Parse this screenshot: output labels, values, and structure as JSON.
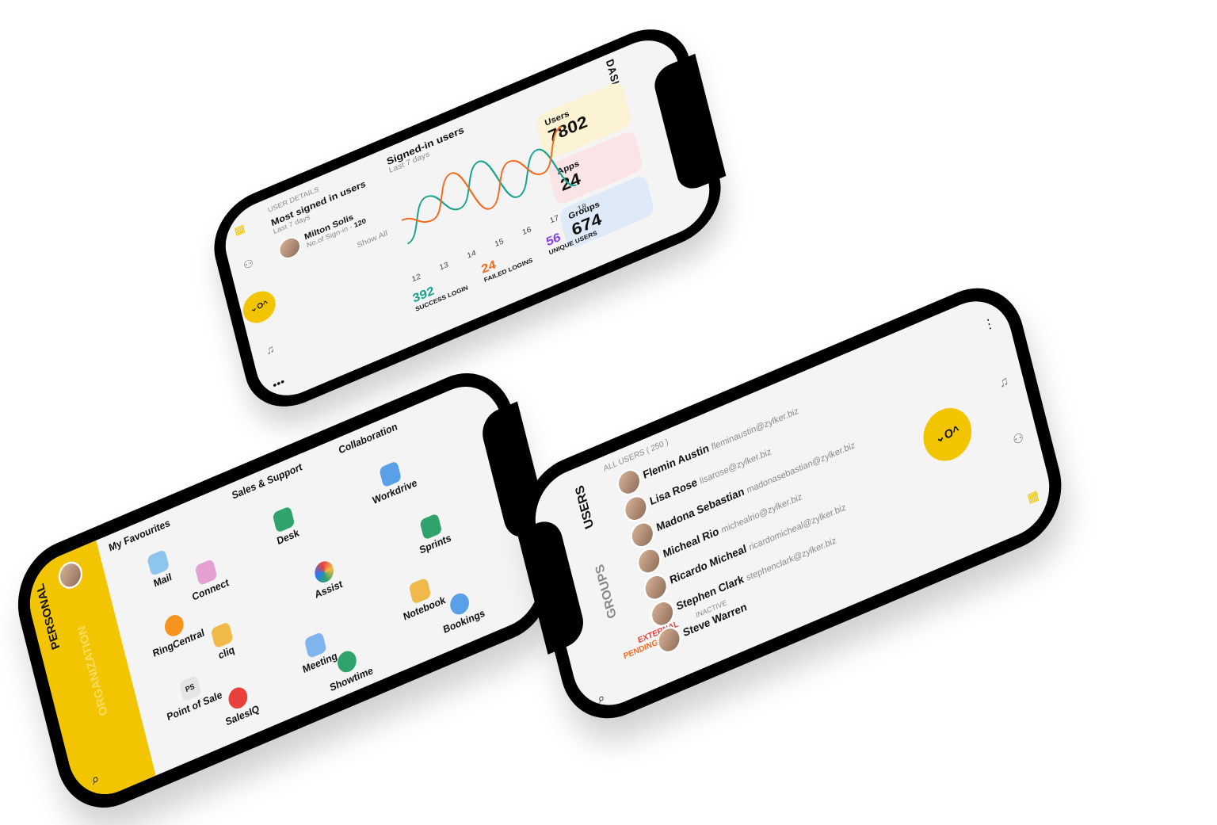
{
  "dashboard": {
    "title": "DASHBOARD",
    "stats": [
      {
        "label": "Users",
        "value": "7802",
        "color": "#fbf3d4",
        "icon": "users-icon"
      },
      {
        "label": "Apps",
        "value": "24",
        "color": "#fbe4e6",
        "icon": "apps-icon"
      },
      {
        "label": "Groups",
        "value": "674",
        "color": "#dfeaf8",
        "icon": "groups-icon"
      }
    ],
    "signed_in": {
      "title": "Signed-in users",
      "subtitle": "Last 7 days"
    },
    "chart_data": {
      "type": "line",
      "x": [
        "12",
        "13",
        "14",
        "15",
        "16",
        "17",
        "18"
      ],
      "series": [
        {
          "values": [
            2,
            5,
            3,
            6,
            2,
            5,
            1
          ],
          "color": "#17a38f"
        },
        {
          "values": [
            4,
            3,
            6,
            2,
            5,
            3,
            6
          ],
          "color": "#f26b22"
        }
      ],
      "summary": [
        {
          "value": "392",
          "label": "SUCCESS LOGIN",
          "color": "#17a38f"
        },
        {
          "value": "24",
          "label": "FAILED LOGINS",
          "color": "#f26b22"
        },
        {
          "value": "56",
          "label": "UNIQUE USERS",
          "color": "#8a3cf0"
        }
      ]
    },
    "user_details": {
      "section": "USER DETAILS",
      "title": "Most signed in users",
      "subtitle": "Last 7 days",
      "name": "Milton Solis",
      "metric_label": "No.of Sign-in -",
      "metric_value": "120",
      "show_all": "Show All"
    }
  },
  "personal": {
    "tab_active": "PERSONAL",
    "tab_inactive": "ORGANIZATION",
    "sections": [
      {
        "title": "My Favourites",
        "apps": [
          "Mail",
          "RingCentral",
          "Point of Sale",
          "Connect",
          "cliq",
          "SalesIQ"
        ]
      },
      {
        "title": "Sales & Support",
        "apps": [
          "Desk",
          "Assist",
          "Meeting",
          "Showtime"
        ]
      },
      {
        "title": "Collaboration",
        "apps": [
          "Workdrive",
          "Sprints",
          "Notebook",
          "Bookings"
        ]
      }
    ],
    "pos_badge": "PS"
  },
  "users": {
    "tab_active": "USERS",
    "tab_inactive": "GROUPS",
    "count_label": "ALL USERS ( 250 )",
    "filters": {
      "pending": "PENDING",
      "external": "EXTERNAL",
      "inactive": "INACTIVE"
    },
    "list": [
      {
        "name": "Flemin Austin",
        "email": "fleminaustin@zylker.biz"
      },
      {
        "name": "Lisa Rose",
        "email": "lisarose@zylker.biz"
      },
      {
        "name": "Madona Sebastian",
        "email": "madonasebastian@zylker.biz"
      },
      {
        "name": "Micheal Rio",
        "email": "michealrio@zylker.biz"
      },
      {
        "name": "Ricardo Micheal",
        "email": "ricardomicheal@zylker.biz"
      },
      {
        "name": "Stephen Clark",
        "email": "stephenclark@zylker.biz"
      },
      {
        "name": "Steve Warren",
        "email": ""
      }
    ]
  },
  "fab_label": "⌄O^",
  "colors": {
    "accent": "#f2c500",
    "teal": "#17a38f",
    "orange": "#f26b22",
    "purple": "#8a3cf0"
  }
}
